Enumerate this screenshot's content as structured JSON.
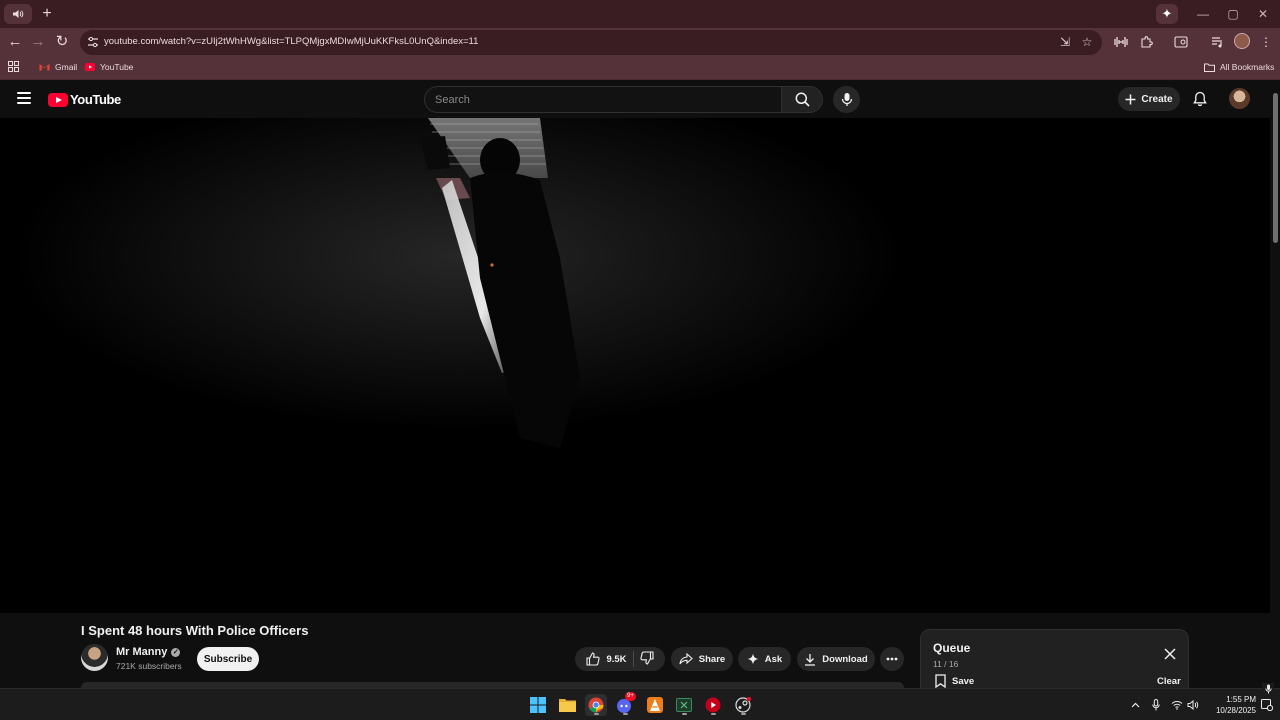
{
  "browser": {
    "url": "youtube.com/watch?v=zUIj2tWhHWg&list=TLPQMjgxMDIwMjUuKKFksL0UnQ&index=11",
    "bookmarks": [
      {
        "label": "Gmail"
      },
      {
        "label": "YouTube"
      }
    ],
    "all_bookmarks_label": "All Bookmarks",
    "accent": "#55323a"
  },
  "youtube": {
    "logo_text": "YouTube",
    "search_placeholder": "Search",
    "create_label": "Create",
    "video": {
      "title": "I Spent 48 hours With Police Officers",
      "channel": "Mr Manny",
      "verified": true,
      "subscribers": "721K subscribers",
      "subscribe_label": "Subscribe",
      "likes": "9.5K",
      "share_label": "Share",
      "ask_label": "Ask",
      "download_label": "Download"
    },
    "queue": {
      "title": "Queue",
      "position": "11 / 16",
      "save_label": "Save",
      "clear_label": "Clear"
    }
  },
  "taskbar": {
    "time": "1:55 PM",
    "date": "10/28/2025",
    "discord_badge": "9+",
    "apps": [
      "start-icon",
      "file-explorer-icon",
      "chrome-icon",
      "discord-icon",
      "vlc-icon",
      "excel-icon",
      "youtube-app-icon",
      "steam-icon"
    ]
  }
}
